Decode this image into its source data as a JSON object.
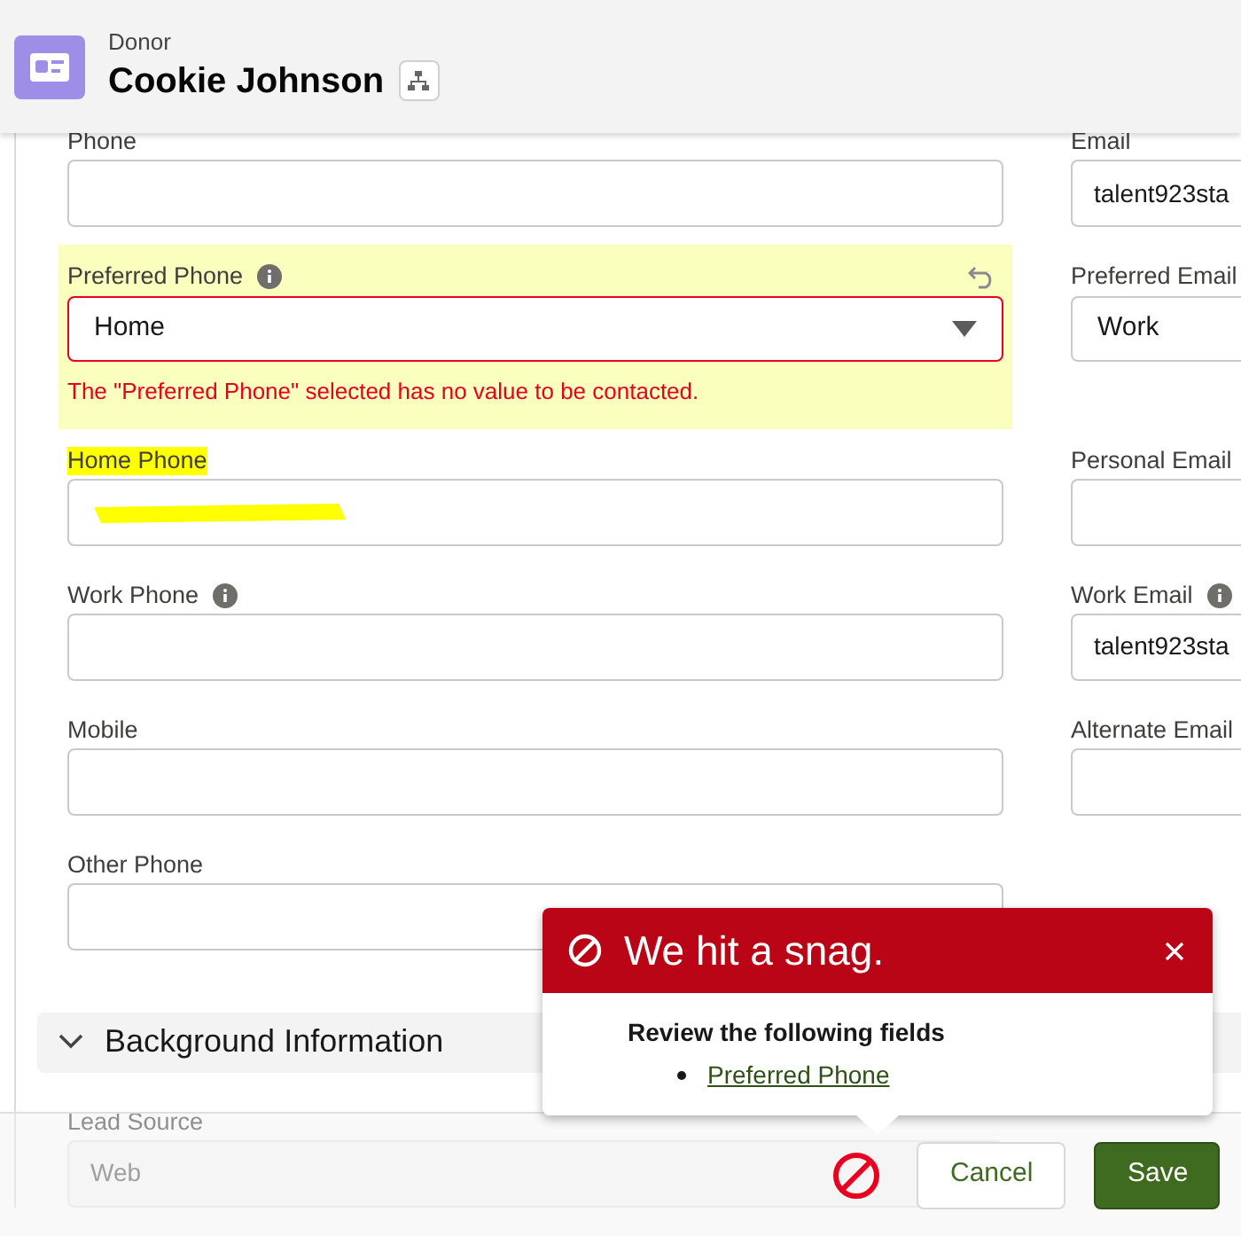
{
  "header": {
    "object_type": "Donor",
    "title": "Cookie Johnson"
  },
  "rows": [
    {
      "left": {
        "label": "Phone",
        "kind": "input"
      },
      "right": {
        "label": "Email",
        "kind": "input",
        "value": "talent923sta"
      }
    },
    {
      "left": {
        "label": "Preferred Phone",
        "kind": "select",
        "value": "Home",
        "info": true,
        "error": "The \"Preferred Phone\" selected has no value to be contacted.",
        "highlighted": true,
        "changed": true
      },
      "right": {
        "label": "Preferred Email",
        "kind": "select",
        "value": "Work"
      }
    },
    {
      "left": {
        "label": "Home Phone",
        "kind": "input",
        "label_highlighted": true,
        "redacted": true
      },
      "right": {
        "label": "Personal Email",
        "kind": "input"
      }
    },
    {
      "left": {
        "label": "Work Phone",
        "kind": "input",
        "info": true
      },
      "right": {
        "label": "Work Email",
        "kind": "input",
        "value": "talent923sta",
        "info": true
      }
    },
    {
      "left": {
        "label": "Mobile",
        "kind": "input"
      },
      "right": {
        "label": "Alternate Email",
        "kind": "input"
      }
    },
    {
      "left": {
        "label": "Other Phone",
        "kind": "input"
      }
    }
  ],
  "section": {
    "title": "Background Information",
    "expanded": true
  },
  "section_fields": {
    "left": {
      "label": "Lead Source",
      "kind": "input",
      "value": "Web",
      "disabled": true
    }
  },
  "error_popover": {
    "title": "We hit a snag.",
    "heading": "Review the following fields",
    "links": [
      "Preferred Phone"
    ]
  },
  "footer": {
    "has_error": true,
    "buttons": [
      {
        "label": "Cancel",
        "kind": "neutral"
      },
      {
        "label": "Save",
        "kind": "brand"
      }
    ]
  }
}
